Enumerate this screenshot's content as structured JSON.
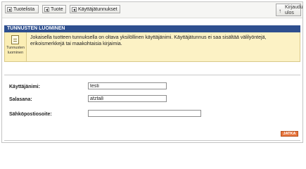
{
  "toolbar": {
    "buttons": [
      {
        "label": "Tuotelista",
        "icon": "back-arrow-icon"
      },
      {
        "label": "Tuote",
        "icon": "back-arrow-icon"
      },
      {
        "label": "Käyttäjätunnukset",
        "icon": "back-arrow-icon"
      }
    ],
    "logout_label": "Kirjaudu ulos",
    "logout_icon": "up-arrow-icon"
  },
  "section": {
    "title": "TUNNUSTEN LUOMINEN",
    "icon_caption": "Tunnusten luominen",
    "description": "Jokaisella tuotteen tunnuksella on oltava yksilöllinen käyttäjänimi. Käyttäjätunnus ei saa sisältää välilyöntejä, erikoismerkkejä tai maakohtaisia kirjaimia."
  },
  "form": {
    "username": {
      "label": "Käyttäjänimi:",
      "value": "testi"
    },
    "password": {
      "label": "Salasana:",
      "value": "afzfa8"
    },
    "email": {
      "label": "Sähköpostiosoite:",
      "value": ""
    },
    "submit_label": "JATKA"
  },
  "colors": {
    "header_bar": "#2e4f8f",
    "info_background": "#fcf2c5",
    "submit_button": "#e8743b"
  }
}
